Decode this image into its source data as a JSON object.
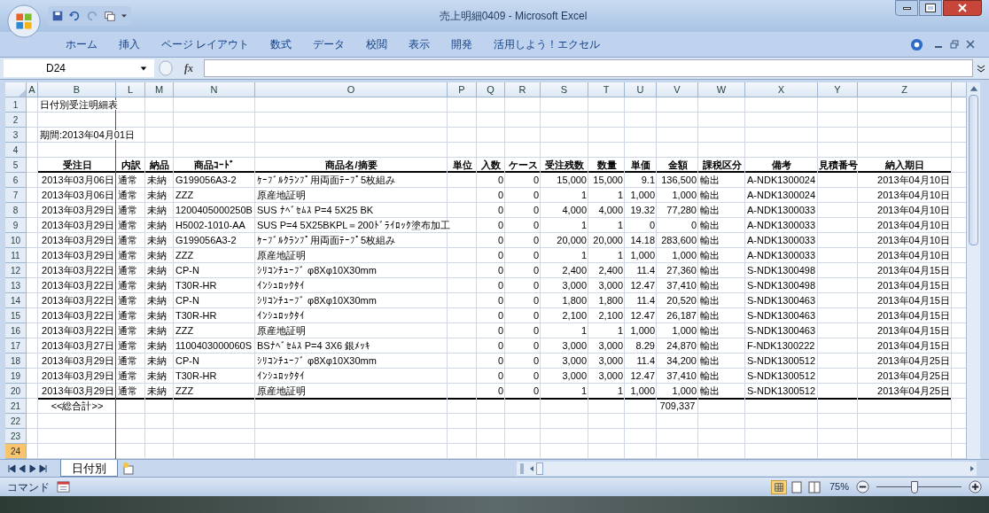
{
  "window": {
    "title": "売上明細0409 - Microsoft Excel"
  },
  "ribbon_tabs": [
    {
      "label": "ホーム",
      "selected": false
    },
    {
      "label": "挿入",
      "selected": false
    },
    {
      "label": "ページ レイアウト",
      "selected": false
    },
    {
      "label": "数式",
      "selected": false
    },
    {
      "label": "データ",
      "selected": false
    },
    {
      "label": "校閲",
      "selected": false
    },
    {
      "label": "表示",
      "selected": false
    },
    {
      "label": "開発",
      "selected": false
    },
    {
      "label": "活用しよう！エクセル",
      "selected": false
    }
  ],
  "formula_bar": {
    "name_box": "D24",
    "function_label": "fx"
  },
  "columns": [
    "A",
    "B",
    "L",
    "M",
    "N",
    "O",
    "P",
    "Q",
    "R",
    "S",
    "T",
    "U",
    "V",
    "W",
    "X",
    "Y",
    "Z"
  ],
  "rows": [
    {
      "number": "1",
      "kind": "title",
      "selected": false,
      "cells": {
        "B": "日付別受注明細表"
      }
    },
    {
      "number": "2",
      "kind": "blank",
      "selected": false
    },
    {
      "number": "3",
      "kind": "title",
      "selected": false,
      "cells": {
        "B": "期間:2013年04月01日"
      }
    },
    {
      "number": "4",
      "kind": "blank",
      "selected": false
    },
    {
      "number": "5",
      "kind": "header",
      "selected": false,
      "cells": {
        "B": "受注日",
        "L": "内訳",
        "M": "納品",
        "N": "商品ｺｰﾄﾞ",
        "O": "商品名/摘要",
        "P": "単位",
        "Q": "入数",
        "R": "ケース",
        "S": "受注残数",
        "T": "数量",
        "U": "単価",
        "V": "金額",
        "W": "課税区分",
        "X": "備考",
        "Y": "見積番号",
        "Z": "納入期日"
      }
    },
    {
      "number": "6",
      "kind": "data",
      "selected": false,
      "cells": {
        "B": "2013年03月06日",
        "L": "通常",
        "M": "未納",
        "N": "G199056A3-2",
        "O": "ｹｰﾌﾞﾙｸﾗﾝﾌﾟ用両面ﾃｰﾌﾟ5枚組み",
        "Q": "0",
        "R": "0",
        "S": "15,000",
        "T": "15,000",
        "U": "9.1",
        "V": "136,500",
        "W": "輸出",
        "X": "A-NDK1300024",
        "Z": "2013年04月10日"
      }
    },
    {
      "number": "7",
      "kind": "data",
      "selected": false,
      "cells": {
        "B": "2013年03月06日",
        "L": "通常",
        "M": "未納",
        "N": "ZZZ",
        "O": "原産地証明",
        "Q": "0",
        "R": "0",
        "S": "1",
        "T": "1",
        "U": "1,000",
        "V": "1,000",
        "W": "輸出",
        "X": "A-NDK1300024",
        "Z": "2013年04月10日"
      }
    },
    {
      "number": "8",
      "kind": "data",
      "selected": false,
      "cells": {
        "B": "2013年03月29日",
        "L": "通常",
        "M": "未納",
        "N": "1200405000250B",
        "O": "SUS ﾅﾍﾞｾﾑｽ P=4 5X25 BK",
        "Q": "0",
        "R": "0",
        "S": "4,000",
        "T": "4,000",
        "U": "19.32",
        "V": "77,280",
        "W": "輸出",
        "X": "A-NDK1300033",
        "Z": "2013年04月10日"
      }
    },
    {
      "number": "9",
      "kind": "data",
      "selected": false,
      "cells": {
        "B": "2013年03月29日",
        "L": "通常",
        "M": "未納",
        "N": "H5002-1010-AA",
        "O": "SUS P=4 5X25BKPL＝200ﾄﾞﾗｲﾛｯｸ塗布加工",
        "Q": "0",
        "R": "0",
        "S": "1",
        "T": "1",
        "U": "0",
        "V": "0",
        "W": "輸出",
        "X": "A-NDK1300033",
        "Z": "2013年04月10日"
      }
    },
    {
      "number": "10",
      "kind": "data",
      "selected": false,
      "cells": {
        "B": "2013年03月29日",
        "L": "通常",
        "M": "未納",
        "N": "G199056A3-2",
        "O": "ｹｰﾌﾞﾙｸﾗﾝﾌﾟ用両面ﾃｰﾌﾟ5枚組み",
        "Q": "0",
        "R": "0",
        "S": "20,000",
        "T": "20,000",
        "U": "14.18",
        "V": "283,600",
        "W": "輸出",
        "X": "A-NDK1300033",
        "Z": "2013年04月10日"
      }
    },
    {
      "number": "11",
      "kind": "data",
      "selected": false,
      "cells": {
        "B": "2013年03月29日",
        "L": "通常",
        "M": "未納",
        "N": "ZZZ",
        "O": "原産地証明",
        "Q": "0",
        "R": "0",
        "S": "1",
        "T": "1",
        "U": "1,000",
        "V": "1,000",
        "W": "輸出",
        "X": "A-NDK1300033",
        "Z": "2013年04月10日"
      }
    },
    {
      "number": "12",
      "kind": "data",
      "selected": false,
      "cells": {
        "B": "2013年03月22日",
        "L": "通常",
        "M": "未納",
        "N": "CP-N",
        "O": "ｼﾘｺﾝﾁｭｰﾌﾞ φ8Xφ10X30mm",
        "Q": "0",
        "R": "0",
        "S": "2,400",
        "T": "2,400",
        "U": "11.4",
        "V": "27,360",
        "W": "輸出",
        "X": "S-NDK1300498",
        "Z": "2013年04月15日"
      }
    },
    {
      "number": "13",
      "kind": "data",
      "selected": false,
      "cells": {
        "B": "2013年03月22日",
        "L": "通常",
        "M": "未納",
        "N": "T30R-HR",
        "O": "ｲﾝｼｭﾛｯｸﾀｲ",
        "Q": "0",
        "R": "0",
        "S": "3,000",
        "T": "3,000",
        "U": "12.47",
        "V": "37,410",
        "W": "輸出",
        "X": "S-NDK1300498",
        "Z": "2013年04月15日"
      }
    },
    {
      "number": "14",
      "kind": "data",
      "selected": false,
      "cells": {
        "B": "2013年03月22日",
        "L": "通常",
        "M": "未納",
        "N": "CP-N",
        "O": "ｼﾘｺﾝﾁｭｰﾌﾞ φ8Xφ10X30mm",
        "Q": "0",
        "R": "0",
        "S": "1,800",
        "T": "1,800",
        "U": "11.4",
        "V": "20,520",
        "W": "輸出",
        "X": "S-NDK1300463",
        "Z": "2013年04月15日"
      }
    },
    {
      "number": "15",
      "kind": "data",
      "selected": false,
      "cells": {
        "B": "2013年03月22日",
        "L": "通常",
        "M": "未納",
        "N": "T30R-HR",
        "O": "ｲﾝｼｭﾛｯｸﾀｲ",
        "Q": "0",
        "R": "0",
        "S": "2,100",
        "T": "2,100",
        "U": "12.47",
        "V": "26,187",
        "W": "輸出",
        "X": "S-NDK1300463",
        "Z": "2013年04月15日"
      }
    },
    {
      "number": "16",
      "kind": "data",
      "selected": false,
      "cells": {
        "B": "2013年03月22日",
        "L": "通常",
        "M": "未納",
        "N": "ZZZ",
        "O": "原産地証明",
        "Q": "0",
        "R": "0",
        "S": "1",
        "T": "1",
        "U": "1,000",
        "V": "1,000",
        "W": "輸出",
        "X": "S-NDK1300463",
        "Z": "2013年04月15日"
      }
    },
    {
      "number": "17",
      "kind": "data",
      "selected": false,
      "cells": {
        "B": "2013年03月27日",
        "L": "通常",
        "M": "未納",
        "N": "1100403000060S",
        "O": "BSﾅﾍﾞｾﾑｽ P=4 3X6 銀ﾒｯｷ",
        "Q": "0",
        "R": "0",
        "S": "3,000",
        "T": "3,000",
        "U": "8.29",
        "V": "24,870",
        "W": "輸出",
        "X": "F-NDK1300222",
        "Z": "2013年04月15日"
      }
    },
    {
      "number": "18",
      "kind": "data",
      "selected": false,
      "cells": {
        "B": "2013年03月29日",
        "L": "通常",
        "M": "未納",
        "N": "CP-N",
        "O": "ｼﾘｺﾝﾁｭｰﾌﾞ φ8Xφ10X30mm",
        "Q": "0",
        "R": "0",
        "S": "3,000",
        "T": "3,000",
        "U": "11.4",
        "V": "34,200",
        "W": "輸出",
        "X": "S-NDK1300512",
        "Z": "2013年04月25日"
      }
    },
    {
      "number": "19",
      "kind": "data",
      "selected": false,
      "cells": {
        "B": "2013年03月29日",
        "L": "通常",
        "M": "未納",
        "N": "T30R-HR",
        "O": "ｲﾝｼｭﾛｯｸﾀｲ",
        "Q": "0",
        "R": "0",
        "S": "3,000",
        "T": "3,000",
        "U": "12.47",
        "V": "37,410",
        "W": "輸出",
        "X": "S-NDK1300512",
        "Z": "2013年04月25日"
      }
    },
    {
      "number": "20",
      "kind": "data",
      "selected": false,
      "cells": {
        "B": "2013年03月29日",
        "L": "通常",
        "M": "未納",
        "N": "ZZZ",
        "O": "原産地証明",
        "Q": "0",
        "R": "0",
        "S": "1",
        "T": "1",
        "U": "1,000",
        "V": "1,000",
        "W": "輸出",
        "X": "S-NDK1300512",
        "Z": "2013年04月25日"
      }
    },
    {
      "number": "21",
      "kind": "total",
      "selected": false,
      "cells": {
        "B": "<<総合計>>",
        "V": "709,337"
      }
    },
    {
      "number": "22",
      "kind": "blank",
      "selected": false
    },
    {
      "number": "23",
      "kind": "blank",
      "selected": false
    },
    {
      "number": "24",
      "kind": "blank",
      "selected": true
    }
  ],
  "sheet_tabs": [
    {
      "label": "日付別",
      "selected": true
    }
  ],
  "status_bar": {
    "mode": "コマンド",
    "zoom_label": "75%",
    "zoom": {
      "level": 0.45
    }
  }
}
